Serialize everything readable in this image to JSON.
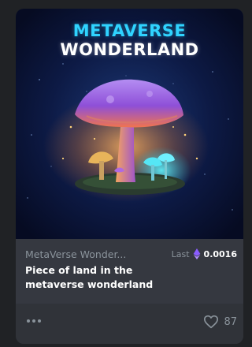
{
  "card": {
    "artwork": {
      "title_line1": "METAVERSE",
      "title_line2": "WONDERLAND"
    },
    "collection_name": "MetaVerse Wonder...",
    "price": {
      "label": "Last",
      "currency_icon": "ethereum-icon",
      "value": "0.0016"
    },
    "item_name": "Piece of land in the metaverse wonderland",
    "footer": {
      "more_icon": "more-horizontal-icon",
      "like_icon": "heart-outline-icon",
      "like_count": "87"
    }
  },
  "colors": {
    "page_bg": "#202225",
    "card_bg": "#303339",
    "info_bg": "#353840",
    "muted_text": "#8a939b",
    "title_cyan": "#2fd3ff",
    "eth_purple": "#8a5cff"
  }
}
